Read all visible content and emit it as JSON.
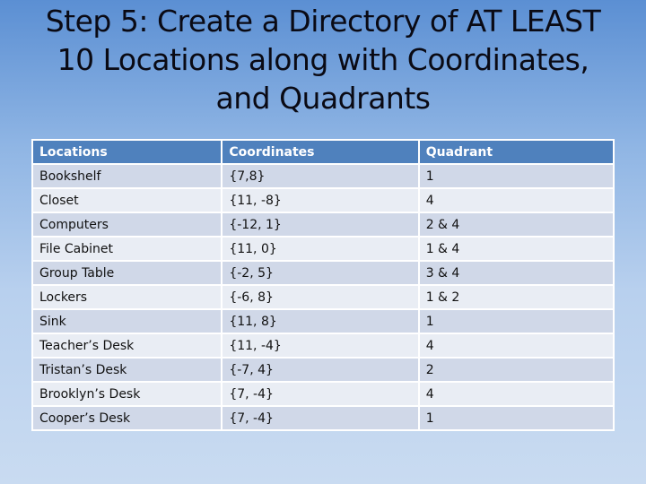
{
  "title": {
    "line1": "Step 5:  Create a Directory of AT LEAST",
    "line2": "10 Locations along with Coordinates,",
    "line3": "and Quadrants"
  },
  "table": {
    "headers": [
      "Locations",
      "Coordinates",
      "Quadrant"
    ],
    "rows": [
      [
        "Bookshelf",
        "{7,8}",
        "1"
      ],
      [
        "Closet",
        "{11, -8}",
        "4"
      ],
      [
        "Computers",
        "{-12, 1}",
        "2 & 4"
      ],
      [
        "File Cabinet",
        "{11, 0}",
        "1 & 4"
      ],
      [
        "Group Table",
        "{-2, 5}",
        "3 & 4"
      ],
      [
        "Lockers",
        "{-6, 8}",
        "1 & 2"
      ],
      [
        "Sink",
        "{11, 8}",
        "1"
      ],
      [
        "Teacher’s Desk",
        "{11, -4}",
        "4"
      ],
      [
        "Tristan’s Desk",
        "{-7, 4}",
        "2"
      ],
      [
        "Brooklyn’s Desk",
        "{7, -4}",
        "4"
      ],
      [
        "Cooper’s Desk",
        "{7, -4}",
        "1"
      ]
    ]
  },
  "colors": {
    "header_bg": "#4f81bd",
    "row_odd": "#d0d8e8",
    "row_even": "#e9edf4"
  }
}
